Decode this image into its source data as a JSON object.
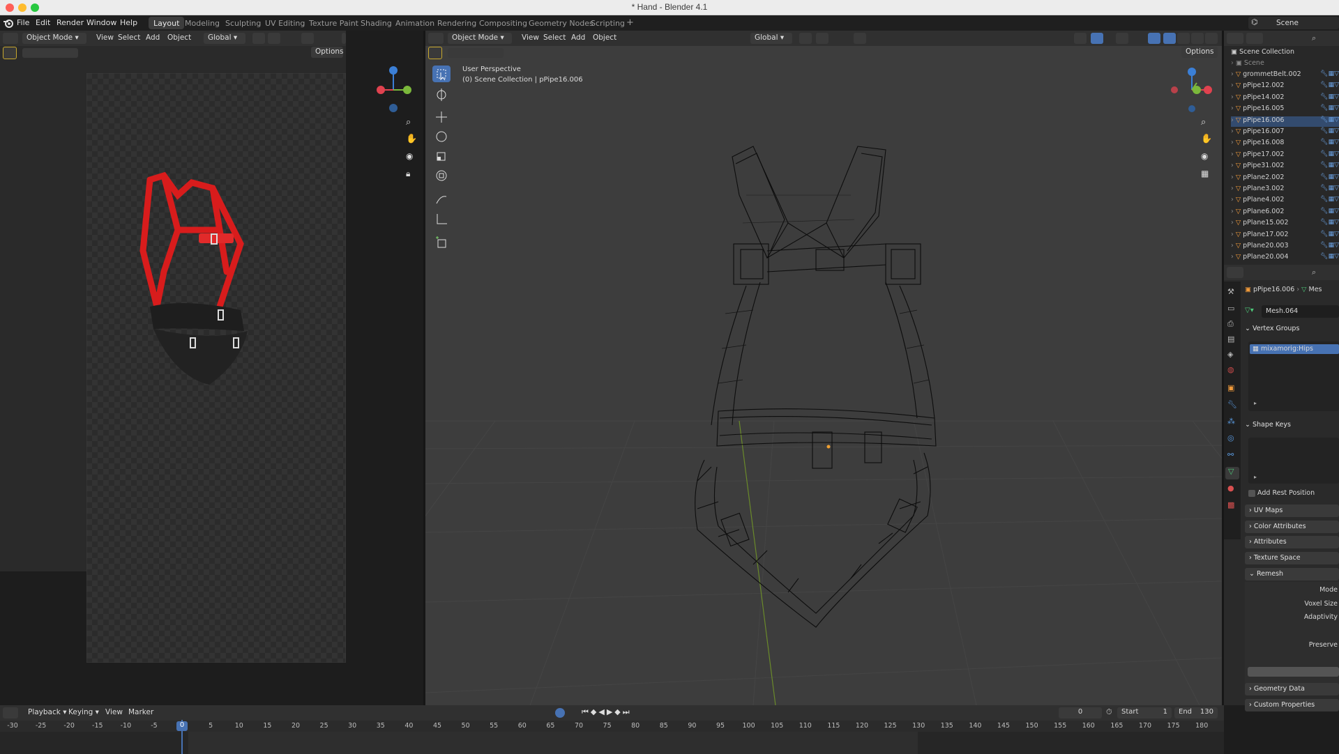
{
  "window": {
    "title": "* Hand - Blender 4.1"
  },
  "menubar": {
    "items": [
      "File",
      "Edit",
      "Render",
      "Window",
      "Help"
    ]
  },
  "workspaces": [
    "Layout",
    "Modeling",
    "Sculpting",
    "UV Editing",
    "Texture Paint",
    "Shading",
    "Animation",
    "Rendering",
    "Compositing",
    "Geometry Nodes",
    "Scripting"
  ],
  "active_workspace": "Layout",
  "scene": {
    "name": "Scene"
  },
  "left_viewport": {
    "mode": "Object Mode",
    "menus": [
      "View",
      "Select",
      "Add",
      "Object"
    ],
    "orientation": "Global",
    "options_label": "Options"
  },
  "main_viewport": {
    "mode": "Object Mode",
    "menus": [
      "View",
      "Select",
      "Add",
      "Object"
    ],
    "orientation": "Global",
    "options_label": "Options",
    "info_line1": "User Perspective",
    "info_line2": "(0) Scene Collection | pPipe16.006"
  },
  "outliner": {
    "root": "Scene Collection",
    "scene_row": "Scene",
    "items": [
      "grommetBelt.002",
      "pPipe12.002",
      "pPipe14.002",
      "pPipe16.005",
      "pPipe16.006",
      "pPipe16.007",
      "pPipe16.008",
      "pPipe17.002",
      "pPipe31.002",
      "pPlane2.002",
      "pPlane3.002",
      "pPlane4.002",
      "pPlane6.002",
      "pPlane15.002",
      "pPlane17.002",
      "pPlane20.003",
      "pPlane20.004"
    ],
    "selected_index": 4
  },
  "properties": {
    "breadcrumb_object": "pPipe16.006",
    "breadcrumb_next": "Mes",
    "mesh_name": "Mesh.064",
    "vertex_groups_label": "Vertex Groups",
    "vertex_group_item": "mixamorig:Hips",
    "shape_keys_label": "Shape Keys",
    "add_rest_position": "Add Rest Position",
    "collapsed_panels": [
      "UV Maps",
      "Color Attributes",
      "Attributes",
      "Texture Space"
    ],
    "remesh_label": "Remesh",
    "remesh_fields": [
      "Mode",
      "Voxel Size",
      "Adaptivity",
      "Preserve"
    ],
    "bottom_panels": [
      "Geometry Data",
      "Custom Properties"
    ]
  },
  "timeline": {
    "menus": [
      "Playback",
      "Keying",
      "View",
      "Marker"
    ],
    "current_frame": "0",
    "start_label": "Start",
    "start_value": "1",
    "end_label": "End",
    "end_value": "130",
    "ticks": [
      "-30",
      "-25",
      "-20",
      "-15",
      "-10",
      "-5",
      "0",
      "5",
      "10",
      "15",
      "20",
      "25",
      "30",
      "35",
      "40",
      "45",
      "50",
      "55",
      "60",
      "65",
      "70",
      "75",
      "80",
      "85",
      "90",
      "95",
      "100",
      "105",
      "110",
      "115",
      "120",
      "125",
      "130",
      "135",
      "140",
      "145",
      "150",
      "155",
      "160",
      "165",
      "170",
      "175",
      "180"
    ]
  },
  "gizmo": {
    "z": "Z",
    "y": "Y",
    "x": "X"
  },
  "colors": {
    "accent": "#4772b3",
    "harness_red": "#d81c1c",
    "x_axis": "#e0424f",
    "y_axis": "#7bb83b",
    "z_axis": "#3b7fd6"
  }
}
